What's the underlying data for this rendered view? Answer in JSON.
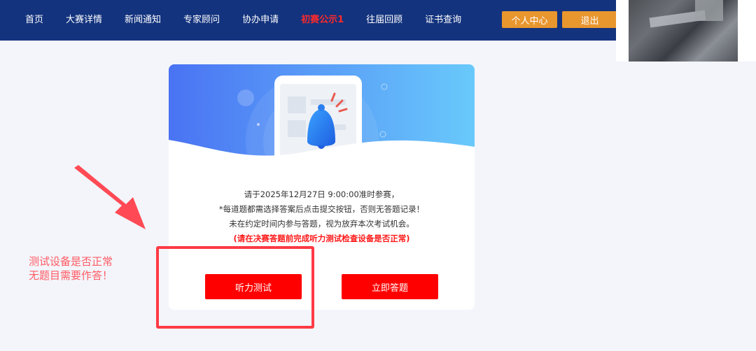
{
  "nav": {
    "items": [
      "首页",
      "大赛详情",
      "新闻通知",
      "专家顾问",
      "协办申请",
      "初赛公示1",
      "往届回顾",
      "证书查询"
    ],
    "active_index": 5,
    "user_center_label": "个人中心",
    "logout_label": "退出"
  },
  "card": {
    "line1": "请于2025年12月27日 9:00:00准时参赛，",
    "line2": "*每道题都需选择答案后点击提交按钮，否则无答题记录！",
    "line3": "未在约定时间内参与答题，视为放弃本次考试机会。",
    "warning": "(请在决赛答题前完成听力测试检查设备是否正常)",
    "listen_test_label": "听力测试",
    "start_answer_label": "立即答题"
  },
  "annotation": {
    "tip_line1": "测试设备是否正常",
    "tip_line2": "无题目需要作答！"
  },
  "colors": {
    "topbar": "#13337e",
    "active_nav": "#ff2a2a",
    "orange_button": "#e8962e",
    "red_button": "#ff0000",
    "annotation": "#ff3a45"
  }
}
